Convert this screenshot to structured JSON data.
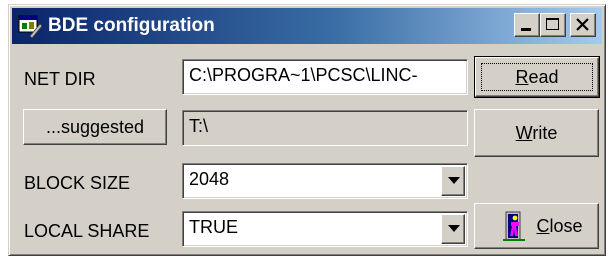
{
  "window": {
    "title": "BDE configuration",
    "title_bar_colors": {
      "start": "#0a246a",
      "end": "#a6caf0"
    },
    "face_color": "#d4d0c8",
    "caption_buttons": [
      "minimize-icon",
      "maximize-icon",
      "close-icon"
    ]
  },
  "form": {
    "net_dir": {
      "label": "NET DIR",
      "value": "C:\\PROGRA~1\\PCSC\\LINC-"
    },
    "suggested": {
      "button_label": "...suggested",
      "value": "T:\\"
    },
    "block_size": {
      "label": "BLOCK SIZE",
      "value": "2048"
    },
    "local_share": {
      "label": "LOCAL SHARE",
      "value": "TRUE"
    }
  },
  "buttons": {
    "read": {
      "mnemonic": "R",
      "rest": "ead"
    },
    "write": {
      "mnemonic": "W",
      "rest": "rite"
    },
    "close": {
      "mnemonic": "C",
      "rest": "lose",
      "icon": "door-exit-icon"
    }
  }
}
